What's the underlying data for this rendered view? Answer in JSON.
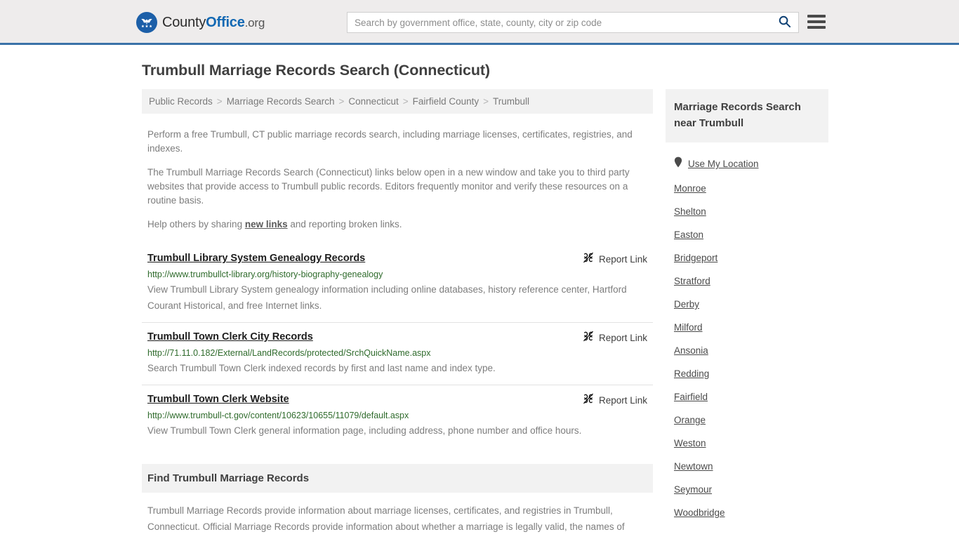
{
  "header": {
    "brand": {
      "part1": "County",
      "part2": "Office",
      "part3": ".org",
      "logo_icon": "eagle-stars-icon"
    },
    "search": {
      "placeholder": "Search by government office, state, county, city or zip code",
      "value": "",
      "search_icon": "search-icon"
    },
    "menu_icon": "hamburger-menu-icon",
    "accent_color": "#3a72a8"
  },
  "page_title": "Trumbull Marriage Records Search (Connecticut)",
  "breadcrumb": {
    "separator": ">",
    "items": [
      {
        "label": "Public Records"
      },
      {
        "label": "Marriage Records Search"
      },
      {
        "label": "Connecticut"
      },
      {
        "label": "Fairfield County"
      },
      {
        "label": "Trumbull"
      }
    ]
  },
  "intro": {
    "p1": "Perform a free Trumbull, CT public marriage records search, including marriage licenses, certificates, registries, and indexes.",
    "p2": "The Trumbull Marriage Records Search (Connecticut) links below open in a new window and take you to third party websites that provide access to Trumbull public records. Editors frequently monitor and verify these resources on a routine basis.",
    "p3_before": "Help others by sharing ",
    "p3_link": "new links",
    "p3_after": " and reporting broken links."
  },
  "report_link": {
    "label": "Report Link",
    "icon": "broken-link-icon"
  },
  "results": [
    {
      "title": "Trumbull Library System Genealogy Records",
      "url": "http://www.trumbullct-library.org/history-biography-genealogy",
      "description": "View Trumbull Library System genealogy information including online databases, history reference center, Hartford Courant Historical, and free Internet links."
    },
    {
      "title": "Trumbull Town Clerk City Records",
      "url": "http://71.11.0.182/External/LandRecords/protected/SrchQuickName.aspx",
      "description": "Search Trumbull Town Clerk indexed records by first and last name and index type."
    },
    {
      "title": "Trumbull Town Clerk Website",
      "url": "http://www.trumbull-ct.gov/content/10623/10655/11079/default.aspx",
      "description": "View Trumbull Town Clerk general information page, including address, phone number and office hours."
    }
  ],
  "find_section": {
    "heading": "Find Trumbull Marriage Records",
    "body": "Trumbull Marriage Records provide information about marriage licenses, certificates, and registries in Trumbull, Connecticut. Official Marriage Records provide information about whether a marriage is legally valid, the names of"
  },
  "sidebar": {
    "heading": "Marriage Records Search near Trumbull",
    "use_my_location": {
      "label": "Use My Location",
      "icon": "map-pin-icon"
    },
    "cities": [
      {
        "label": "Monroe"
      },
      {
        "label": "Shelton"
      },
      {
        "label": "Easton"
      },
      {
        "label": "Bridgeport"
      },
      {
        "label": "Stratford"
      },
      {
        "label": "Derby"
      },
      {
        "label": "Milford"
      },
      {
        "label": "Ansonia"
      },
      {
        "label": "Redding"
      },
      {
        "label": "Fairfield"
      },
      {
        "label": "Orange"
      },
      {
        "label": "Weston"
      },
      {
        "label": "Newtown"
      },
      {
        "label": "Seymour"
      },
      {
        "label": "Woodbridge"
      }
    ]
  }
}
